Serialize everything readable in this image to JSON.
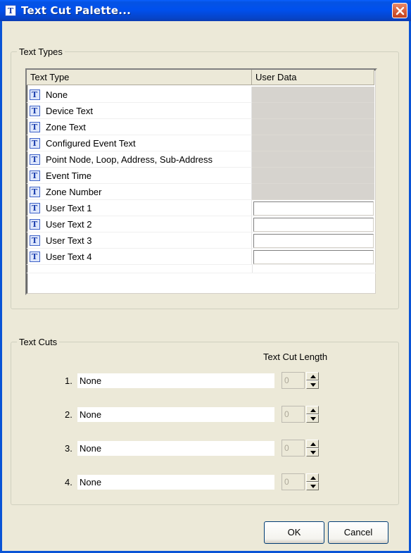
{
  "window": {
    "title": "Text Cut Palette..."
  },
  "text_types": {
    "legend": "Text Types",
    "columns": {
      "type": "Text Type",
      "user_data": "User Data"
    },
    "rows": [
      {
        "label": "None",
        "editable": false
      },
      {
        "label": "Device Text",
        "editable": false
      },
      {
        "label": "Zone Text",
        "editable": false
      },
      {
        "label": "Configured Event Text",
        "editable": false
      },
      {
        "label": "Point Node, Loop, Address, Sub-Address",
        "editable": false
      },
      {
        "label": "Event Time",
        "editable": false
      },
      {
        "label": "Zone Number",
        "editable": false
      },
      {
        "label": "User Text 1",
        "editable": true
      },
      {
        "label": "User Text 2",
        "editable": true
      },
      {
        "label": "User Text 3",
        "editable": true
      },
      {
        "label": "User Text 4",
        "editable": true
      }
    ]
  },
  "text_cuts": {
    "legend": "Text Cuts",
    "length_header": "Text Cut Length",
    "items": [
      {
        "number": "1.",
        "value": "None",
        "length": "0"
      },
      {
        "number": "2.",
        "value": "None",
        "length": "0"
      },
      {
        "number": "3.",
        "value": "None",
        "length": "0"
      },
      {
        "number": "4.",
        "value": "None",
        "length": "0"
      }
    ]
  },
  "buttons": {
    "ok": "OK",
    "cancel": "Cancel"
  },
  "colors": {
    "titlebar": "#0050ee",
    "dialog": "#ece9d8",
    "disabled_cell": "#d6d3ce",
    "close": "#d45c3a"
  }
}
